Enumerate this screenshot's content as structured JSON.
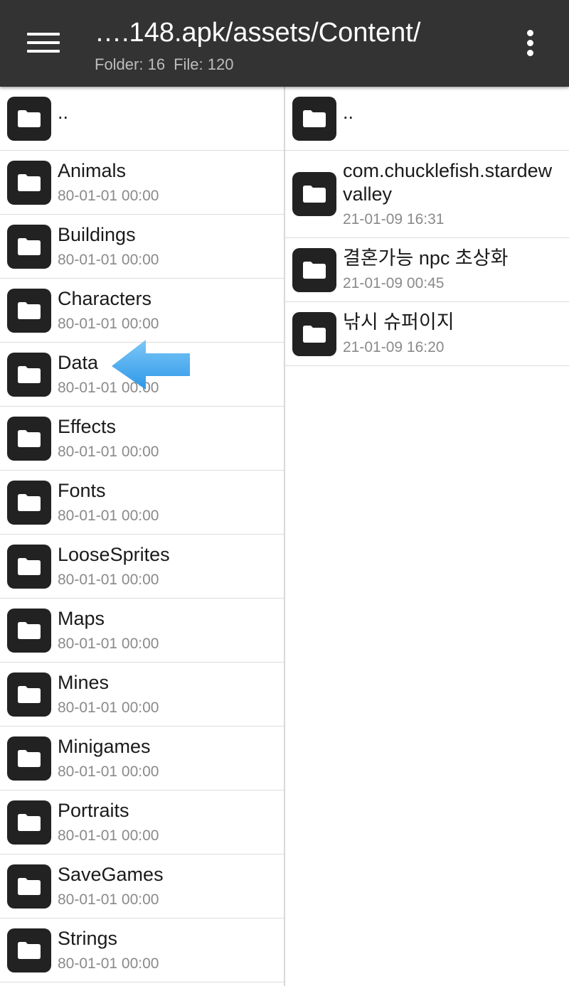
{
  "header": {
    "title": "….148.apk/assets/Content/",
    "folder_count": "Folder: 16",
    "file_count": "File: 120"
  },
  "left_pane": {
    "parent": "..",
    "items": [
      {
        "name": "Animals",
        "date": "80-01-01 00:00"
      },
      {
        "name": "Buildings",
        "date": "80-01-01 00:00"
      },
      {
        "name": "Characters",
        "date": "80-01-01 00:00"
      },
      {
        "name": "Data",
        "date": "80-01-01 00:00"
      },
      {
        "name": "Effects",
        "date": "80-01-01 00:00"
      },
      {
        "name": "Fonts",
        "date": "80-01-01 00:00"
      },
      {
        "name": "LooseSprites",
        "date": "80-01-01 00:00"
      },
      {
        "name": "Maps",
        "date": "80-01-01 00:00"
      },
      {
        "name": "Mines",
        "date": "80-01-01 00:00"
      },
      {
        "name": "Minigames",
        "date": "80-01-01 00:00"
      },
      {
        "name": "Portraits",
        "date": "80-01-01 00:00"
      },
      {
        "name": "SaveGames",
        "date": "80-01-01 00:00"
      },
      {
        "name": "Strings",
        "date": "80-01-01 00:00"
      }
    ]
  },
  "right_pane": {
    "parent": "..",
    "items": [
      {
        "name": "com.chucklefish.stardewvalley",
        "date": "21-01-09 16:31"
      },
      {
        "name": "결혼가능 npc 초상화",
        "date": "21-01-09 00:45"
      },
      {
        "name": "낚시 슈퍼이지",
        "date": "21-01-09 16:20"
      }
    ]
  },
  "icons": {
    "menu": "hamburger-menu-icon",
    "more": "more-vert-icon",
    "folder": "folder-icon",
    "pointer": "blue-arrow-pointer"
  },
  "colors": {
    "appbar": "#333333",
    "folder_tile": "#222222",
    "arrow": "#3fa9f5"
  }
}
